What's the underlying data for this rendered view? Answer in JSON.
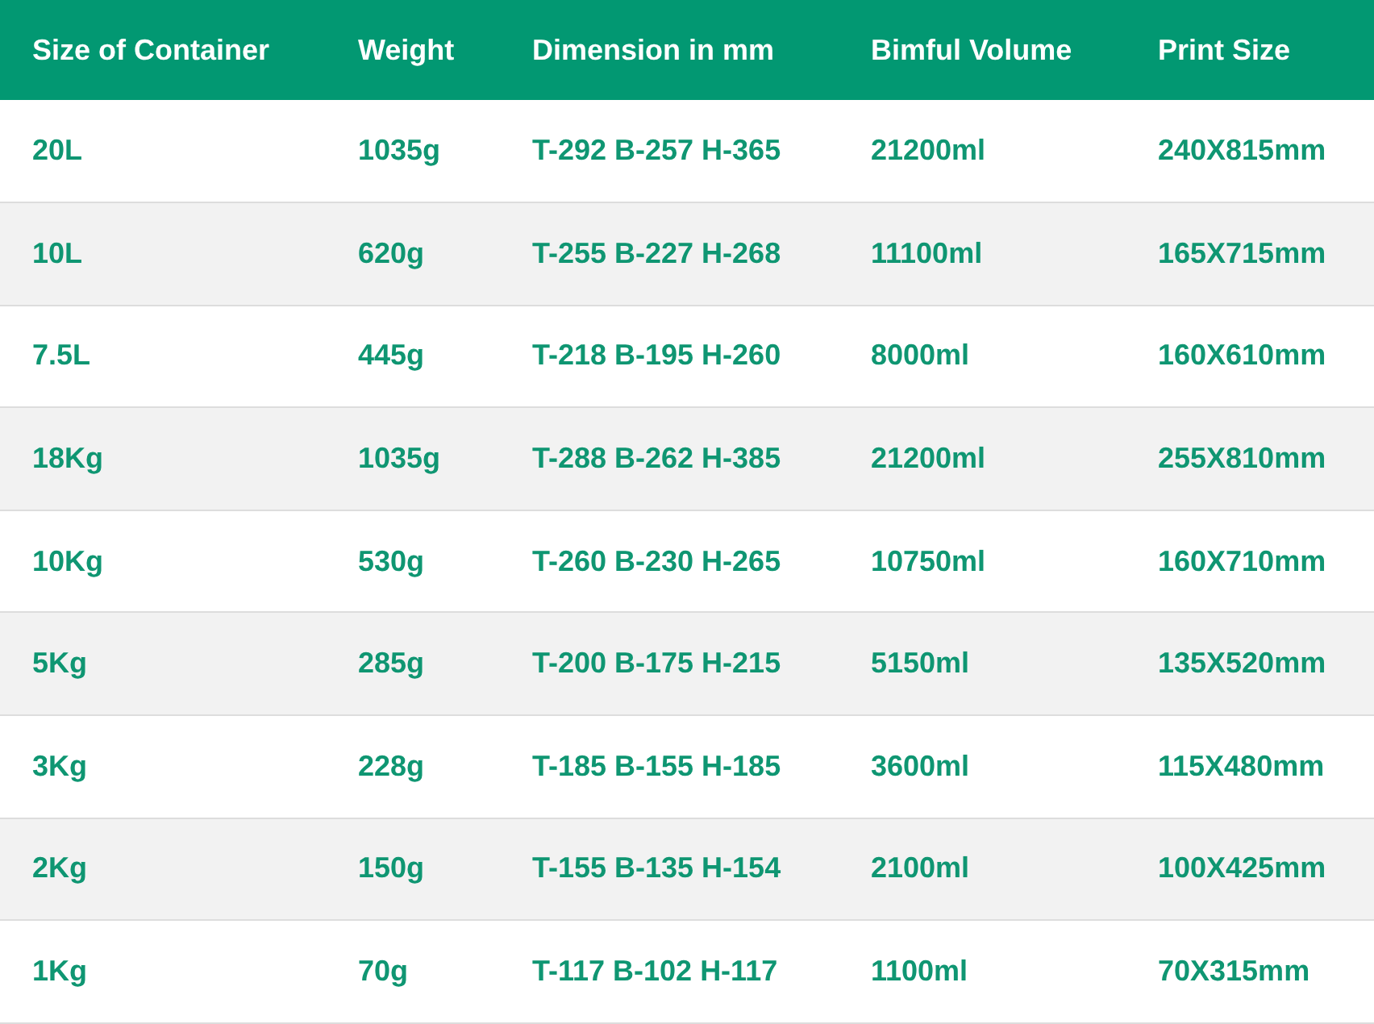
{
  "table": {
    "columns": [
      "Size of Container",
      "Weight",
      "Dimension in mm",
      "Bimful Volume",
      "Print Size"
    ],
    "rows": [
      [
        "20L",
        "1035g",
        "T-292 B-257 H-365",
        "21200ml",
        "240X815mm"
      ],
      [
        "10L",
        "620g",
        "T-255 B-227 H-268",
        "11100ml",
        "165X715mm"
      ],
      [
        "7.5L",
        "445g",
        "T-218 B-195 H-260",
        "8000ml",
        "160X610mm"
      ],
      [
        "18Kg",
        "1035g",
        "T-288 B-262 H-385",
        "21200ml",
        "255X810mm"
      ],
      [
        "10Kg",
        "530g",
        "T-260 B-230 H-265",
        "10750ml",
        "160X710mm"
      ],
      [
        "5Kg",
        "285g",
        "T-200 B-175 H-215",
        "5150ml",
        "135X520mm"
      ],
      [
        "3Kg",
        "228g",
        "T-185 B-155 H-185",
        "3600ml",
        "115X480mm"
      ],
      [
        "2Kg",
        "150g",
        "T-155 B-135 H-154",
        "2100ml",
        "100X425mm"
      ],
      [
        "1Kg",
        "70g",
        "T-117 B-102 H-117",
        "1100ml",
        "70X315mm"
      ]
    ]
  }
}
